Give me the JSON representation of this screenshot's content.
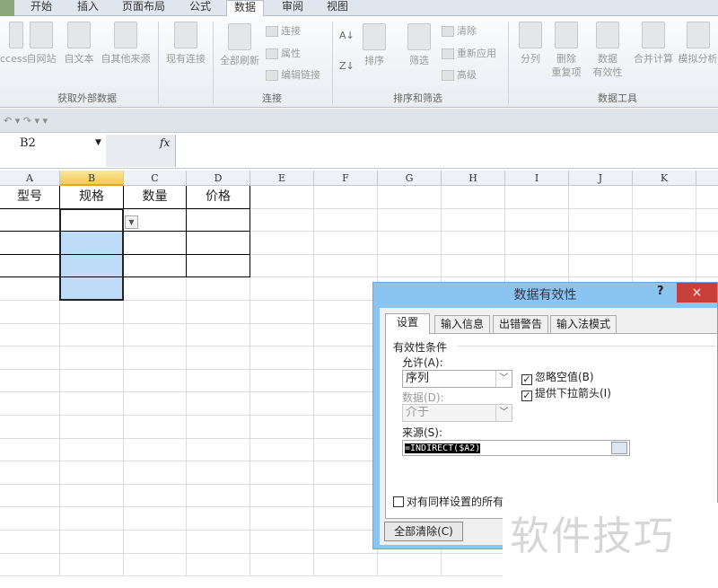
{
  "menu_tabs": [
    "开始",
    "插入",
    "页面布局",
    "公式",
    "数据",
    "审阅",
    "视图"
  ],
  "active_tab": "数据",
  "ribbon": {
    "get_external": {
      "buttons": [
        "ccess",
        "自网站",
        "自文本",
        "自其他来源",
        "现有连接"
      ],
      "group": "获取外部数据"
    },
    "connections": {
      "refresh": "全部刷新",
      "items": [
        "连接",
        "属性",
        "编辑链接"
      ],
      "group": "连接"
    },
    "sort_filter": {
      "sort": "排序",
      "filter": "筛选",
      "items": [
        "清除",
        "重新应用",
        "高级"
      ],
      "group": "排序和筛选"
    },
    "data_tools": {
      "buttons": [
        "分列",
        "删除\n重复项",
        "数据\n有效性",
        "合并计算",
        "模拟分析"
      ],
      "group": "数据工具"
    }
  },
  "name_box": "B2",
  "fx": "fx",
  "columns": [
    "A",
    "B",
    "C",
    "D",
    "E",
    "F",
    "G",
    "H",
    "I",
    "J",
    "K"
  ],
  "selected_column": "B",
  "header_row": [
    "型号",
    "规格",
    "数量",
    "价格"
  ],
  "dialog": {
    "title": "数据有效性",
    "help": "?",
    "close": "×",
    "tabs": [
      "设置",
      "输入信息",
      "出错警告",
      "输入法模式"
    ],
    "section": "有效性条件",
    "allow_label": "允许(A):",
    "allow_value": "序列",
    "data_label": "数据(D):",
    "data_value": "介于",
    "ignore_blank": "忽略空值(B)",
    "dropdown": "提供下拉箭头(I)",
    "source_label": "来源(S):",
    "source_value": "=INDIRECT($A2)",
    "apply_all": "对有同样设置的所有",
    "clear_all": "全部清除(C)"
  },
  "watermark": "软件技巧"
}
